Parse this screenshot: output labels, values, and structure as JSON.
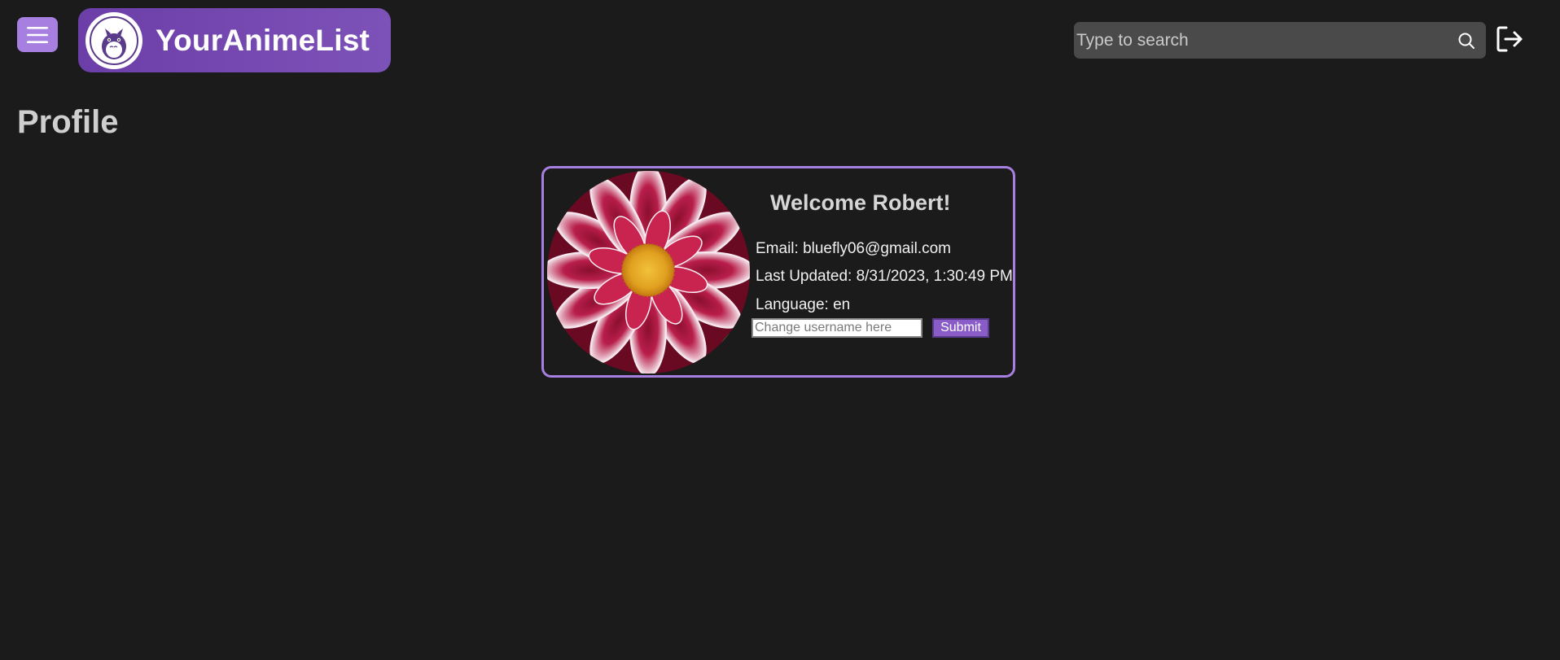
{
  "header": {
    "menu_icon": "hamburger-menu-icon",
    "brand_logo_icon": "totoro-logo-icon",
    "brand_name": "YourAnimeList",
    "search_placeholder": "Type to search",
    "search_icon": "search-icon",
    "logout_icon": "logout-icon"
  },
  "page": {
    "title": "Profile"
  },
  "profile": {
    "avatar_description_icon": "profile-avatar-flower",
    "welcome": "Welcome Robert!",
    "email": "Email: bluefly06@gmail.com",
    "last_updated": "Last Updated: 8/31/2023, 1:30:49 PM",
    "language": "Language: en",
    "username_placeholder": "Change username here",
    "submit_label": "Submit"
  },
  "colors": {
    "background": "#1b1b1b",
    "accent": "#a77fe0",
    "brand_gradient_start": "#6c3ea8",
    "brand_gradient_end": "#7d52b8",
    "search_bg": "#4a4a4a"
  }
}
